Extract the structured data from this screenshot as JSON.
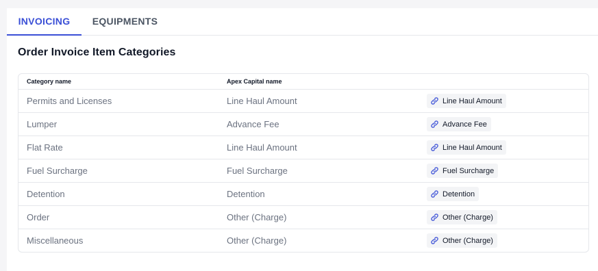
{
  "tabs": [
    {
      "label": "INVOICING",
      "active": true
    },
    {
      "label": "EQUIPMENTS",
      "active": false
    }
  ],
  "section_title": "Order Invoice Item Categories",
  "table": {
    "headers": [
      "Category name",
      "Apex Capital name"
    ],
    "rows": [
      {
        "category": "Permits and Licenses",
        "apex": "Line Haul Amount",
        "link": "Line Haul Amount"
      },
      {
        "category": "Lumper",
        "apex": "Advance Fee",
        "link": "Advance Fee"
      },
      {
        "category": "Flat Rate",
        "apex": "Line Haul Amount",
        "link": "Line Haul Amount"
      },
      {
        "category": "Fuel Surcharge",
        "apex": "Fuel Surcharge",
        "link": "Fuel Surcharge"
      },
      {
        "category": "Detention",
        "apex": "Detention",
        "link": "Detention"
      },
      {
        "category": "Order",
        "apex": "Other (Charge)",
        "link": "Other (Charge)"
      },
      {
        "category": "Miscellaneous",
        "apex": "Other (Charge)",
        "link": "Other (Charge)"
      }
    ]
  },
  "icons": {
    "link": "link-icon"
  },
  "colors": {
    "accent": "#3a4fd6",
    "chip_bg": "#f3f4f6",
    "border": "#e5e7eb"
  }
}
